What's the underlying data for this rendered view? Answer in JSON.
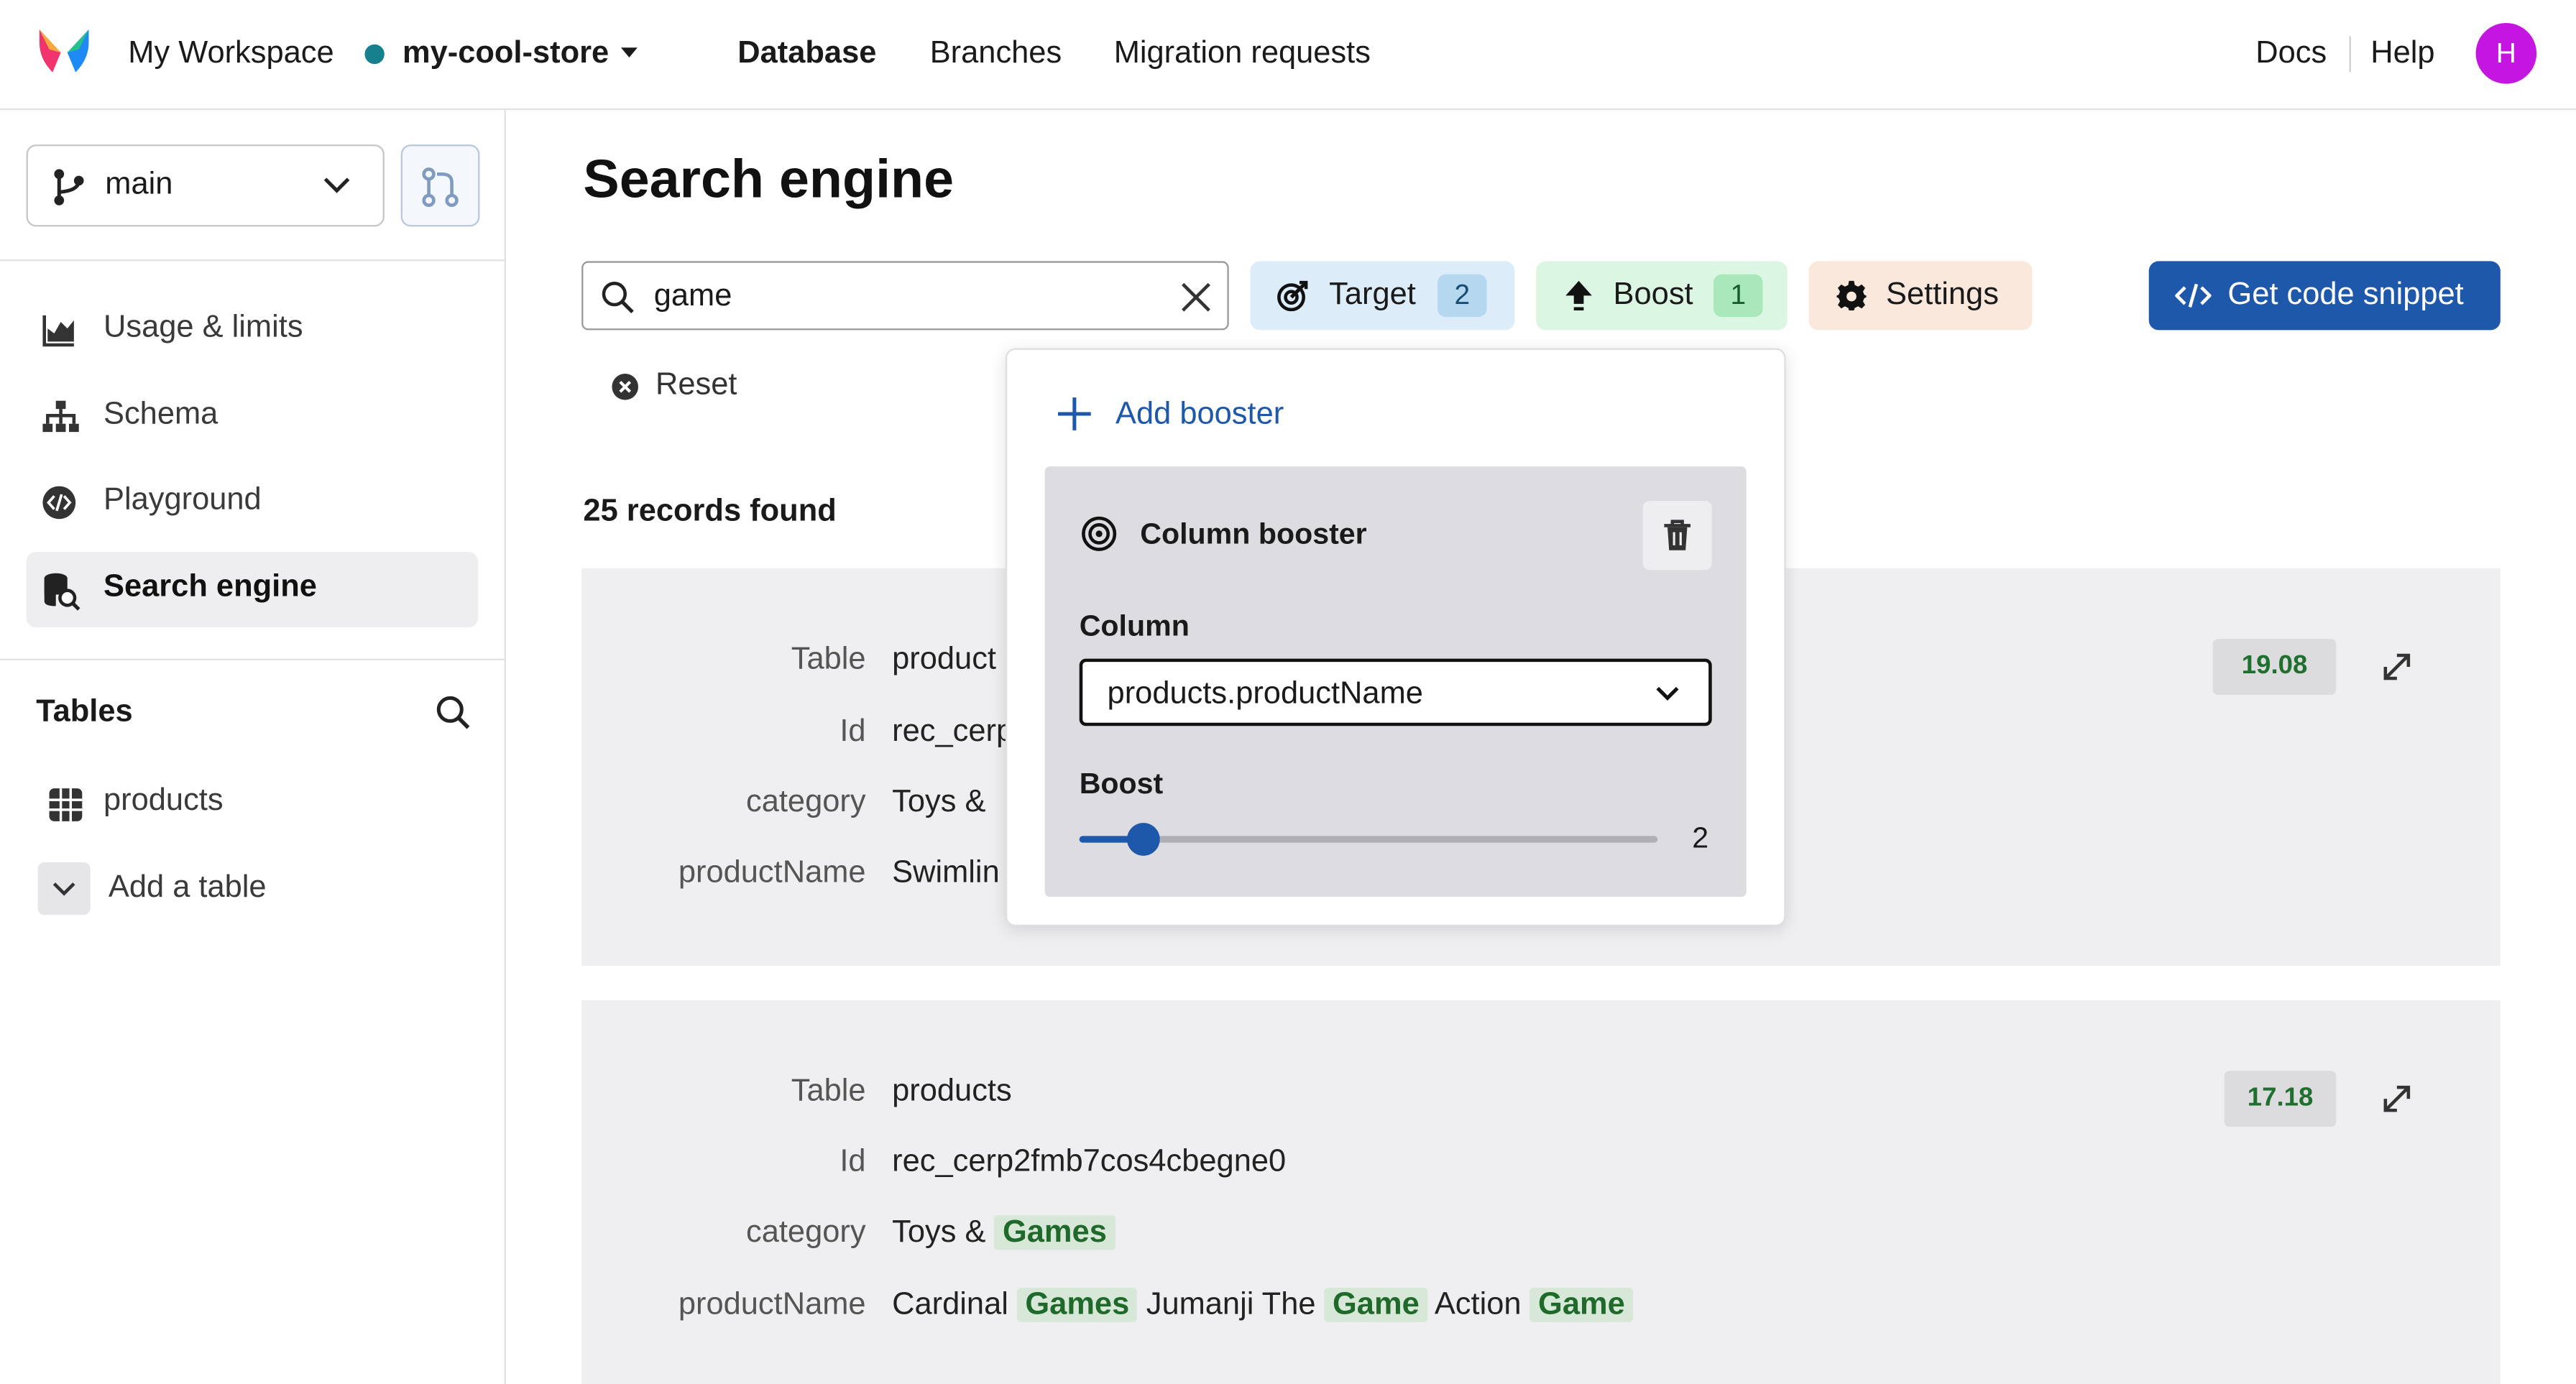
{
  "colors": {
    "accent": "#1e58aa",
    "avatar": "#c516e1",
    "db_status": "#17808f",
    "target_pill": "#dcedf9",
    "boost_pill": "#dbf7e3",
    "settings_pill": "#fbe8dc",
    "highlight_text": "#1f6a2b"
  },
  "topbar": {
    "workspace": "My Workspace",
    "database": "my-cool-store",
    "nav": [
      "Database",
      "Branches",
      "Migration requests"
    ],
    "docs": "Docs",
    "help": "Help",
    "avatar_initial": "H"
  },
  "sidebar": {
    "branch": "main",
    "items": [
      {
        "label": "Usage & limits",
        "icon": "chart-icon"
      },
      {
        "label": "Schema",
        "icon": "schema-icon"
      },
      {
        "label": "Playground",
        "icon": "code-circle-icon"
      },
      {
        "label": "Search engine",
        "icon": "database-search-icon"
      }
    ],
    "tables_heading": "Tables",
    "tables": [
      "products"
    ],
    "add_table": "Add a table"
  },
  "main": {
    "title": "Search engine",
    "search": {
      "value": "game"
    },
    "target": {
      "label": "Target",
      "count": "2"
    },
    "boost": {
      "label": "Boost",
      "count": "1"
    },
    "settings": {
      "label": "Settings"
    },
    "code_button": "Get code snippet",
    "reset": "Reset",
    "records": "25 records found",
    "results": [
      {
        "score": "19.08",
        "fields": {
          "Table": "product",
          "Id": "rec_cerp",
          "category": "Toys &",
          "productName": "Swimlin"
        }
      },
      {
        "score": "17.18",
        "fields": {
          "Table": "products",
          "Id": "rec_cerp2fmb7cos4cbegne0",
          "category_prefix": "Toys &",
          "category_hl": "Games",
          "productName_1": "Cardinal",
          "productName_hl1": "Games",
          "productName_2": "Jumanji The",
          "productName_hl2": "Game",
          "productName_3": "Action",
          "productName_hl3": "Game"
        }
      }
    ],
    "field_labels": [
      "Table",
      "Id",
      "category",
      "productName"
    ]
  },
  "popover": {
    "add_booster": "Add booster",
    "booster_title": "Column booster",
    "column_label": "Column",
    "column_value": "products.productName",
    "boost_label": "Boost",
    "boost_value": "2",
    "boost_fraction": 0.11
  }
}
